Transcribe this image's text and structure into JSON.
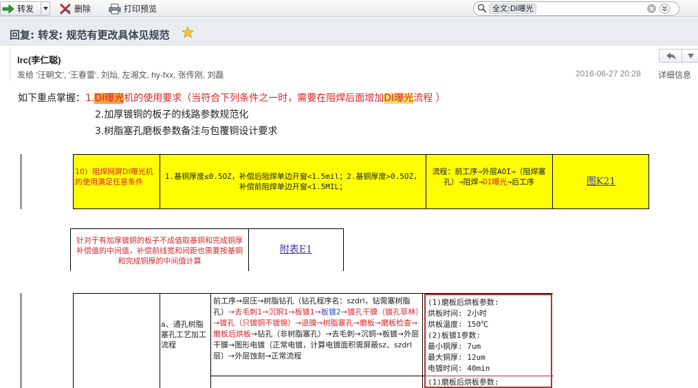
{
  "toolbar": {
    "forward_label": "转发",
    "delete_label": "删除",
    "print_label": "打印预览",
    "search": {
      "scope_label": "全文:DI曝光",
      "value": ""
    }
  },
  "message": {
    "subject": "回复: 转发: 规范有更改具体见规范",
    "sender": "lrc(李仁聪)",
    "recipients": "发给 '汪朝文', '王春蕾', 刘灿, 左湘文, hy-fxx, 张传刚, 刘磊",
    "datetime": "2016-06-27 20:28",
    "details_link": "详细信息"
  },
  "body": {
    "intro": "如下重点掌握：",
    "item1_prefix": "1.",
    "item1_hl1": "DI曝光",
    "item1_mid": "机的使用要求（当符合下列条件之一时，需要在阻焊后面增加",
    "item1_hl2": "DI曝光",
    "item1_suffix": "流程 ）",
    "item2": "2.加厚镀铜的板子的线路参数规范化",
    "item3": "3.树脂塞孔磨板参数备注与包覆铜设计要求"
  },
  "table1": {
    "c1": "10）阻焊网屏DI曝光机的使用满足任意条件",
    "c2": "1.基铜厚度≤0.5OZ，补偿后阻焊单边开窗<1.5mil；2.基铜厚度>0.5OZ，补偿前阻焊单边开窗<1.5MIL；",
    "c3_a": "流程：前工序→外层AOI→（阻焊塞孔）→阻焊→",
    "c3_red": "DI曝光",
    "c3_b": "→后工序",
    "c4_link": "图K21"
  },
  "table2": {
    "c1": "针对于有加厚镀铜的板子不成值取基铜和完成铜厚补偿值的中间值，补偿前线宽和间距也需要按基铜和完成铜厚的中间值计算",
    "c2_link": "附表E1"
  },
  "table3": {
    "label": "a、通孔树脂塞孔工艺加工流程",
    "flow_a": "前工序→层压→树脂钻孔（钻孔程序名：szdrl，钻需塞树脂孔）",
    "flow_red1": "→去毛刺1→沉铜1→板镀1→",
    "flow_blue": "板镀2",
    "flow_red2": "→镀孔干膜（镀孔菲林）→镀孔（只镀铜不镀锡）→退膜→树脂塞孔→磨板→磨板检查→磨板后烘板",
    "flow_b": "→钻孔（非树脂塞孔）→去毛刺→沉铜→板镀→外层干膜→图形电镀（正常电镀，计算电镀面积需屏蔽sz、szdrl层）→外层蚀刻→正常流程",
    "params": [
      "(1)磨板后烘板参数:",
      "烘板时间: 2小时",
      "烘板温度: 150℃",
      "(2)板镀1参数:",
      "最小铜厚: 7um",
      "最大铜厚: 12um",
      "电镀时间: 40min"
    ],
    "params_next": "(1)磨板后烘板参数:"
  }
}
